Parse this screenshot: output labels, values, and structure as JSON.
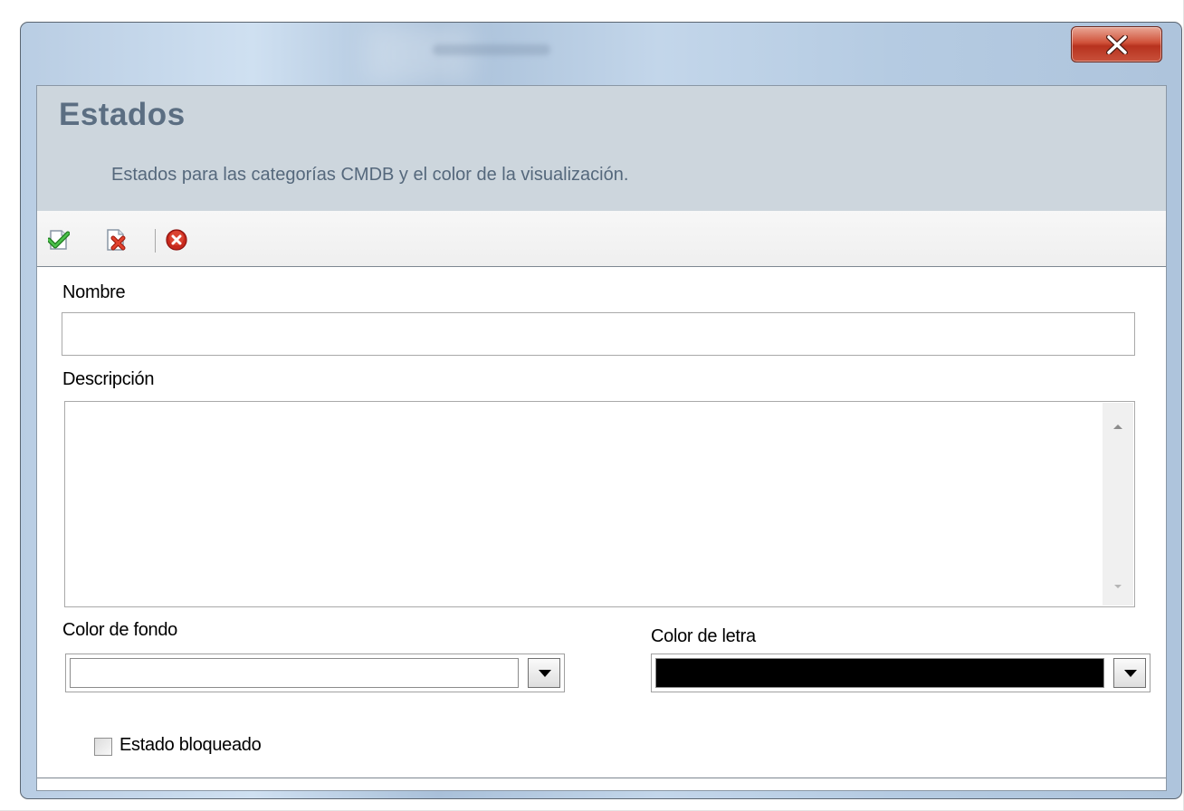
{
  "window": {
    "title": "",
    "close_label": "x"
  },
  "header": {
    "title": "Estados",
    "subtitle": "Estados para las categorías CMDB y el color de la visualización."
  },
  "toolbar": {
    "accept_icon": "accept-page-icon",
    "discard_icon": "discard-page-icon",
    "close_icon": "red-close-icon"
  },
  "form": {
    "nombre_label": "Nombre",
    "nombre_value": "",
    "descripcion_label": "Descripción",
    "descripcion_value": "",
    "color_fondo_label": "Color de fondo",
    "color_fondo_value": "#ffffff",
    "color_letra_label": "Color de letra",
    "color_letra_value": "#000000",
    "bloqueado_label": "Estado bloqueado",
    "bloqueado_checked": false
  }
}
